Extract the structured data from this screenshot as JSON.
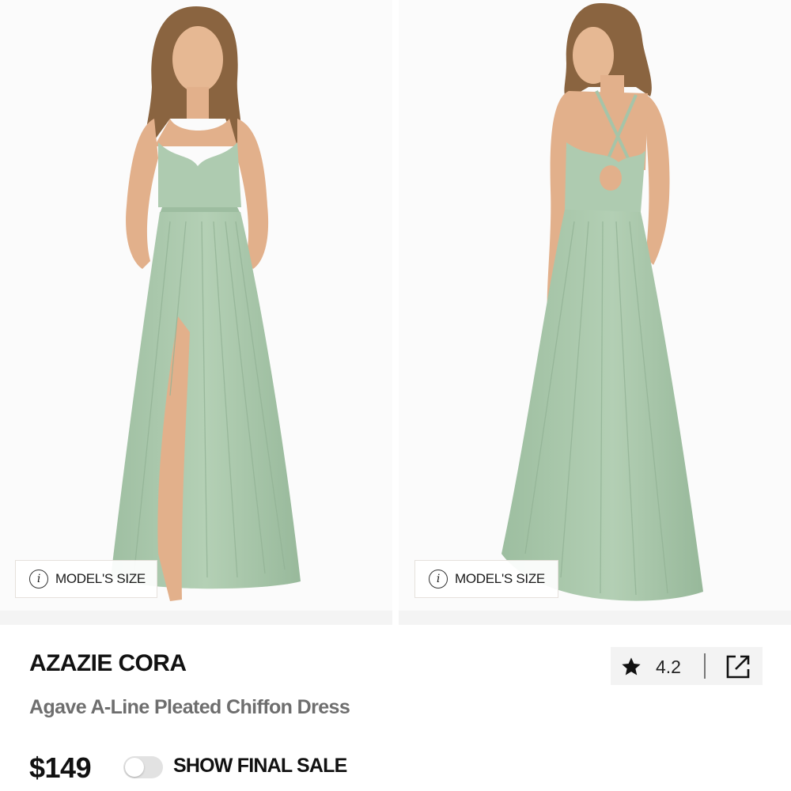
{
  "gallery": {
    "images": [
      {
        "view": "front",
        "model_size_label": "MODEL'S SIZE",
        "info_icon": "info-icon"
      },
      {
        "view": "back",
        "model_size_label": "MODEL'S SIZE",
        "info_icon": "info-icon"
      }
    ]
  },
  "product": {
    "brand": "AZAZIE CORA",
    "name": "Agave A-Line Pleated Chiffon Dress",
    "price": "$149",
    "dress_color": "#a9c7ab"
  },
  "rating": {
    "icon": "star-icon",
    "value": "4.2",
    "share_icon": "share-external-icon"
  },
  "final_sale_toggle": {
    "label": "SHOW FINAL SALE",
    "checked": false
  }
}
